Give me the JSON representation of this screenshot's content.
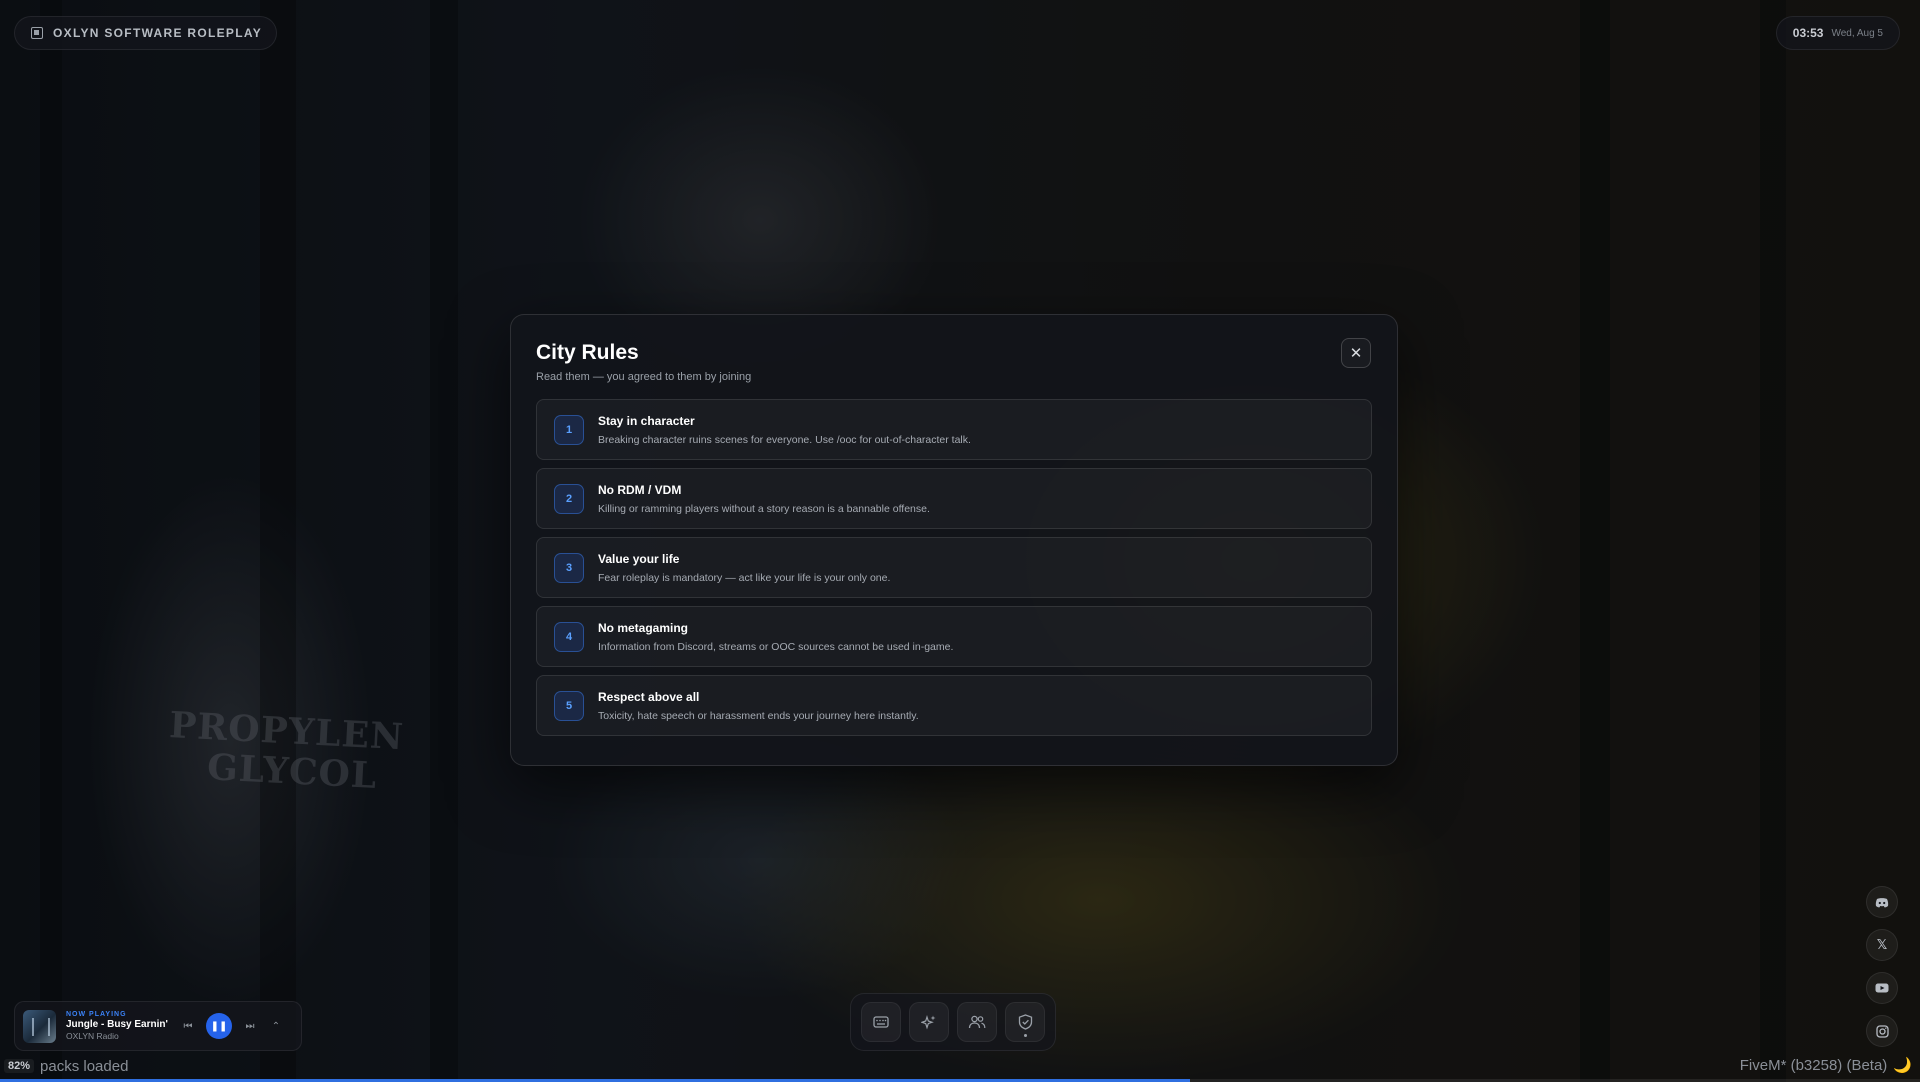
{
  "brand": {
    "name": "OXLYN SOFTWARE ROLEPLAY"
  },
  "clock": {
    "time": "03:53",
    "date": "Wed, Aug 5"
  },
  "background": {
    "label_line1": "PROPYLEN",
    "label_line2": "GLYCOL"
  },
  "modal": {
    "title": "City Rules",
    "subtitle": "Read them — you agreed to them by joining",
    "close_icon": "close-icon",
    "rules": [
      {
        "num": "1",
        "title": "Stay in character",
        "desc": "Breaking character ruins scenes for everyone. Use /ooc for out-of-character talk."
      },
      {
        "num": "2",
        "title": "No RDM / VDM",
        "desc": "Killing or ramming players without a story reason is a bannable offense."
      },
      {
        "num": "3",
        "title": "Value your life",
        "desc": "Fear roleplay is mandatory — act like your life is your only one."
      },
      {
        "num": "4",
        "title": "No metagaming",
        "desc": "Information from Discord, streams or OOC sources cannot be used in-game."
      },
      {
        "num": "5",
        "title": "Respect above all",
        "desc": "Toxicity, hate speech or harassment ends your journey here instantly."
      }
    ]
  },
  "player": {
    "label": "NOW PLAYING",
    "track": "Jungle - Busy Earnin'",
    "artist": "OXLYN Radio",
    "icons": {
      "prev": "skip-back-icon",
      "play": "pause-icon",
      "next": "skip-forward-icon",
      "expand": "chevron-up-icon"
    }
  },
  "dock": {
    "buttons": [
      "keyboard-icon",
      "sparkles-icon",
      "users-icon",
      "shield-check-icon"
    ],
    "active": "shield-check-icon"
  },
  "socials": [
    "discord-icon",
    "x-icon",
    "youtube-icon",
    "instagram-icon"
  ],
  "status": {
    "percent": "82%",
    "loading_text": "packs loaded",
    "progress_fraction": 0.62,
    "client": "FiveM* (b3258) (Beta)"
  },
  "colors": {
    "accent": "#2563eb",
    "accent_text": "#5aa0ff",
    "moon": "#f0c24a"
  }
}
